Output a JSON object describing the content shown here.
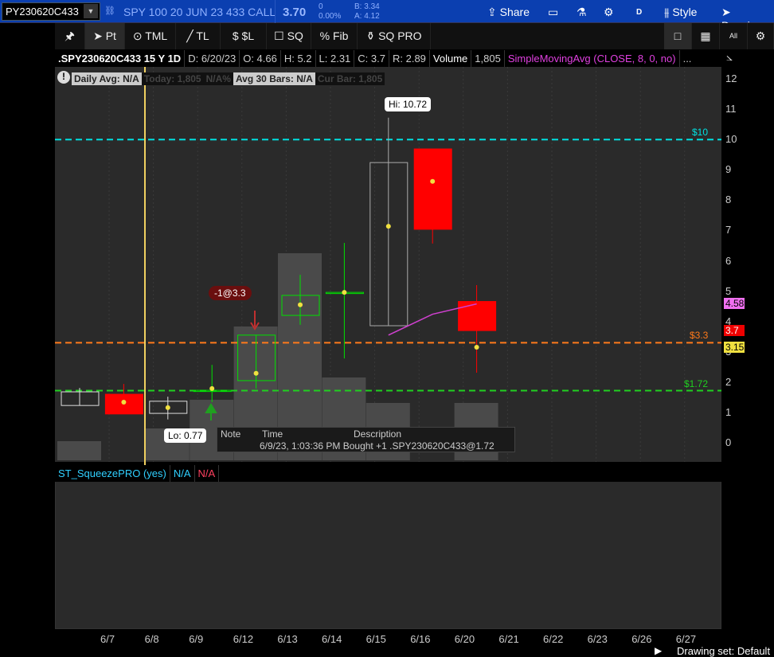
{
  "topbar": {
    "symbol": "PY230620C433",
    "description": "SPY 100 20 JUN 23 433 CALL",
    "last": "3.70",
    "change": "0",
    "change_pct": "0.00%",
    "bid": "B: 3.34",
    "ask": "A: 4.12",
    "share": "Share",
    "period": "D",
    "style": "Style",
    "drawings": "Drawings"
  },
  "toolbar": {
    "tools": [
      "Pt",
      "TML",
      "TL",
      "$L",
      "SQ",
      "Fib",
      "SQ PRO"
    ],
    "right": [
      "□",
      "▦",
      "All",
      "⚙"
    ]
  },
  "info": {
    "symbol": ".SPY230620C433 15 Y 1D",
    "date": "D: 6/20/23",
    "open": "O: 4.66",
    "high": "H: 5.2",
    "low": "L: 2.31",
    "close": "C: 3.7",
    "range": "R: 2.89",
    "volume_label": "Volume",
    "volume": "1,805",
    "study": "SimpleMovingAvg (CLOSE, 8, 0, no)",
    "more": "..."
  },
  "stats": {
    "daily_avg": "Daily Avg: N/A",
    "today": "Today: 1,805",
    "pct": "N/A%",
    "avg30": "Avg 30 Bars: N/A",
    "cur_bar": "Cur Bar: 1,805"
  },
  "annotations": {
    "hi": "Hi: 10.72",
    "lo": "Lo: 0.77",
    "order": "-1@3.3",
    "line_10": "$10",
    "line_33": "$3.3",
    "line_172": "$1.72"
  },
  "note": {
    "h_note": "Note",
    "h_time": "Time",
    "h_desc": "Description",
    "row": "6/9/23, 1:03:36 PM Bought +1 .SPY230620C433@1.72"
  },
  "lower": {
    "study": "ST_SqueezePRO (yes)",
    "v1": "N/A",
    "v2": "N/A"
  },
  "badges": {
    "sma": "4.58",
    "last": "3.7",
    "mark": "3.15"
  },
  "footer": {
    "drawing_set": "Drawing set: Default"
  },
  "colors": {
    "up": "#00e000",
    "down": "#ff0000",
    "sma": "#d040d0",
    "cyan": "#00e0e0",
    "orange": "#ff7a1a",
    "green": "#20d020"
  },
  "chart_data": {
    "type": "candlestick",
    "y_ticks": [
      12,
      11,
      10,
      9,
      8,
      7,
      6,
      5,
      4,
      3,
      2,
      1,
      0
    ],
    "ylim": [
      -0.6,
      12.4
    ],
    "dates": [
      "6/7",
      "6/8",
      "6/9",
      "6/12",
      "6/13",
      "6/14",
      "6/15",
      "6/16",
      "6/20",
      "6/21",
      "6/22",
      "6/23",
      "6/26",
      "6/27"
    ],
    "candles": [
      {
        "o": 1.68,
        "h": 1.81,
        "l": 1.23,
        "c": 1.23,
        "style": "hollow-white"
      },
      {
        "o": 1.6,
        "h": 1.94,
        "l": 0.95,
        "c": 0.95,
        "style": "red"
      },
      {
        "o": 1.37,
        "h": 1.52,
        "l": 0.77,
        "c": 0.97,
        "style": "hollow-white"
      },
      {
        "o": 1.73,
        "h": 2.57,
        "l": 1.34,
        "c": 1.73,
        "style": "green"
      },
      {
        "o": 2.05,
        "h": 3.55,
        "l": 1.79,
        "c": 3.55,
        "style": "green"
      },
      {
        "o": 4.2,
        "h": 5.54,
        "l": 3.89,
        "c": 4.86,
        "style": "green"
      },
      {
        "o": 4.96,
        "h": 6.59,
        "l": 2.78,
        "c": 4.96,
        "style": "green"
      },
      {
        "o": 3.86,
        "h": 10.72,
        "l": 3.86,
        "c": 9.24,
        "style": "hollow-white"
      },
      {
        "o": 9.69,
        "h": 9.69,
        "l": 6.57,
        "c": 7.04,
        "style": "red"
      },
      {
        "o": 4.66,
        "h": 5.2,
        "l": 2.31,
        "c": 3.7,
        "style": "red"
      }
    ],
    "marks": [
      null,
      1.34,
      1.16,
      1.79,
      2.29,
      4.55,
      4.96,
      7.14,
      8.62,
      3.15
    ],
    "volume": [
      0.6,
      0.0,
      1.0,
      1.9,
      4.2,
      6.5,
      2.6,
      1.8,
      0,
      1.8
    ],
    "sma": [
      [
        7,
        3.55
      ],
      [
        8,
        4.24
      ],
      [
        9,
        4.58
      ]
    ],
    "levels": [
      10,
      3.3,
      1.72
    ]
  }
}
